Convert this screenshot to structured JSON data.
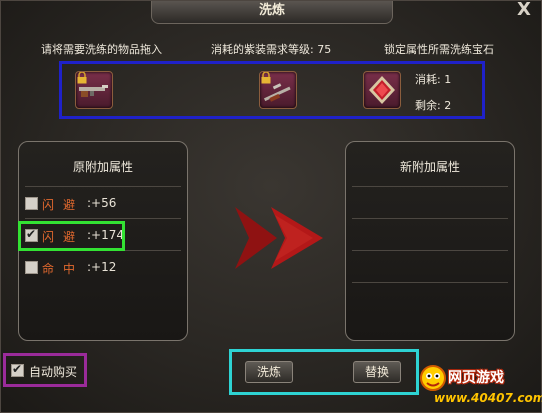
{
  "window": {
    "title": "洗炼",
    "close_glyph": "X"
  },
  "header": {
    "drag_hint": "请将需要洗练的物品拖入",
    "level_req": "消耗的紫装需求等级: 75",
    "lock_hint": "锁定属性所需洗练宝石"
  },
  "cost": {
    "consume": "消耗:  1",
    "remain": "剩余:  2"
  },
  "left_panel": {
    "title": "原附加属性",
    "attrs": [
      {
        "name": "闪避",
        "value": ":+56",
        "checked": false
      },
      {
        "name": "闪避",
        "value": ":+174",
        "checked": true
      },
      {
        "name": "命中",
        "value": ":+12",
        "checked": false
      }
    ]
  },
  "right_panel": {
    "title": "新附加属性"
  },
  "auto_buy": {
    "label": "自动购买",
    "checked": true
  },
  "buttons": {
    "refine": "洗炼",
    "replace": "替换"
  },
  "brand": {
    "name": "网页游戏",
    "url": "www.40407.com"
  },
  "colors": {
    "attr_name": "#e0682e",
    "arrow": "#b31818",
    "highlight_blue": "#1f21c9",
    "highlight_green": "#33e233",
    "highlight_purple": "#9a2b9a",
    "highlight_cyan": "#2ed3d3"
  }
}
